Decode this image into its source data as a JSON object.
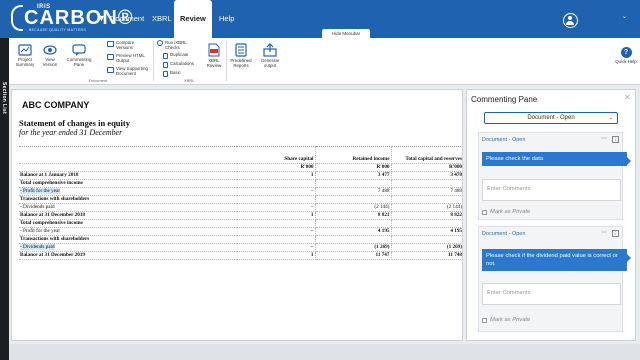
{
  "app": {
    "brand_top": "IRIS",
    "brand_main": "CARBON®",
    "brand_tagline": "BECAUSE QUALITY MATTERS"
  },
  "nav": {
    "tabs": [
      {
        "label": "Document"
      },
      {
        "label": "XBRL"
      },
      {
        "label": "Review"
      },
      {
        "label": "Help"
      }
    ],
    "hide_menubar": "Hide Menubar"
  },
  "ribbon": {
    "buttons": {
      "project_summary": "Project Summary",
      "view_version": "View Version",
      "commenting_pane": "Commenting Pane",
      "compare_versions": "Compare Versions",
      "preview_html": "Preview HTML Output",
      "view_supporting": "View Supporting Document",
      "ixbrl_checks": "Run iXBRL Checks",
      "duplicate": "Duplicate",
      "calculations": "Calculations",
      "basic": "Basic",
      "xbrl_review": "XBRL Review",
      "predefined_reports": "Predefined Reports",
      "generate_output": "Generate output",
      "quick_help": "Quick Help"
    },
    "groups": {
      "document": "Document",
      "xbrl": "XBRL"
    }
  },
  "left_strip": {
    "label": "Section List"
  },
  "document": {
    "company": "ABC COMPANY",
    "title": "Statement of changes in equity",
    "subtitle": "for the year ended 31 December",
    "columns": [
      "Share capital",
      "Retained income",
      "Total capital and reserves"
    ],
    "units": [
      "R'000",
      "R'000",
      "R'000"
    ],
    "rows": [
      {
        "label": "Balance at 1 January 2018",
        "bold": true,
        "c1": "1",
        "c2": "3 477",
        "c3": "3 478"
      },
      {
        "label": "Total comprehensive income",
        "bold": true,
        "c1": "",
        "c2": "",
        "c3": ""
      },
      {
        "label": "- Profit for the year",
        "hl": true,
        "c1": "–",
        "c2": "7 488",
        "c3": "7 488"
      },
      {
        "label": "Transactions with shareholders",
        "bold": true,
        "c1": "",
        "c2": "",
        "c3": ""
      },
      {
        "label": "- Dividends paid",
        "c1": "–",
        "c2": "(2 144)",
        "c3": "(2 144)"
      },
      {
        "label": "Balance at 31 December 2018",
        "bold": true,
        "c1": "1",
        "c2": "8 821",
        "c3": "8 822"
      },
      {
        "label": "Total comprehensive income",
        "bold": true,
        "c1": "",
        "c2": "",
        "c3": ""
      },
      {
        "label": "- Profit for the year",
        "c1": "–",
        "c2": "4 195",
        "c3": "4 195",
        "numbold": true
      },
      {
        "label": "Transactions with shareholders",
        "bold": true,
        "c1": "",
        "c2": "",
        "c3": ""
      },
      {
        "label": "- Dividends paid",
        "hl": true,
        "c1": "–",
        "c2": "(1 269)",
        "c3": "(1 269)",
        "numbold": true
      },
      {
        "label": "Balance at 31 December 2019",
        "bold": true,
        "c1": "1",
        "c2": "11 747",
        "c3": "11 748"
      }
    ]
  },
  "pane": {
    "title": "Commenting Pane",
    "filter_value": "Document - Open",
    "comments": [
      {
        "header": "Document - Open",
        "message": "Please check the data",
        "placeholder": "Enter Comments",
        "private_label": "Mark as Private"
      },
      {
        "header": "Document - Open",
        "message": "Please check if the dividend paid value is correct or not.",
        "placeholder": "Enter Comments",
        "private_label": "Mark as Private"
      }
    ]
  }
}
